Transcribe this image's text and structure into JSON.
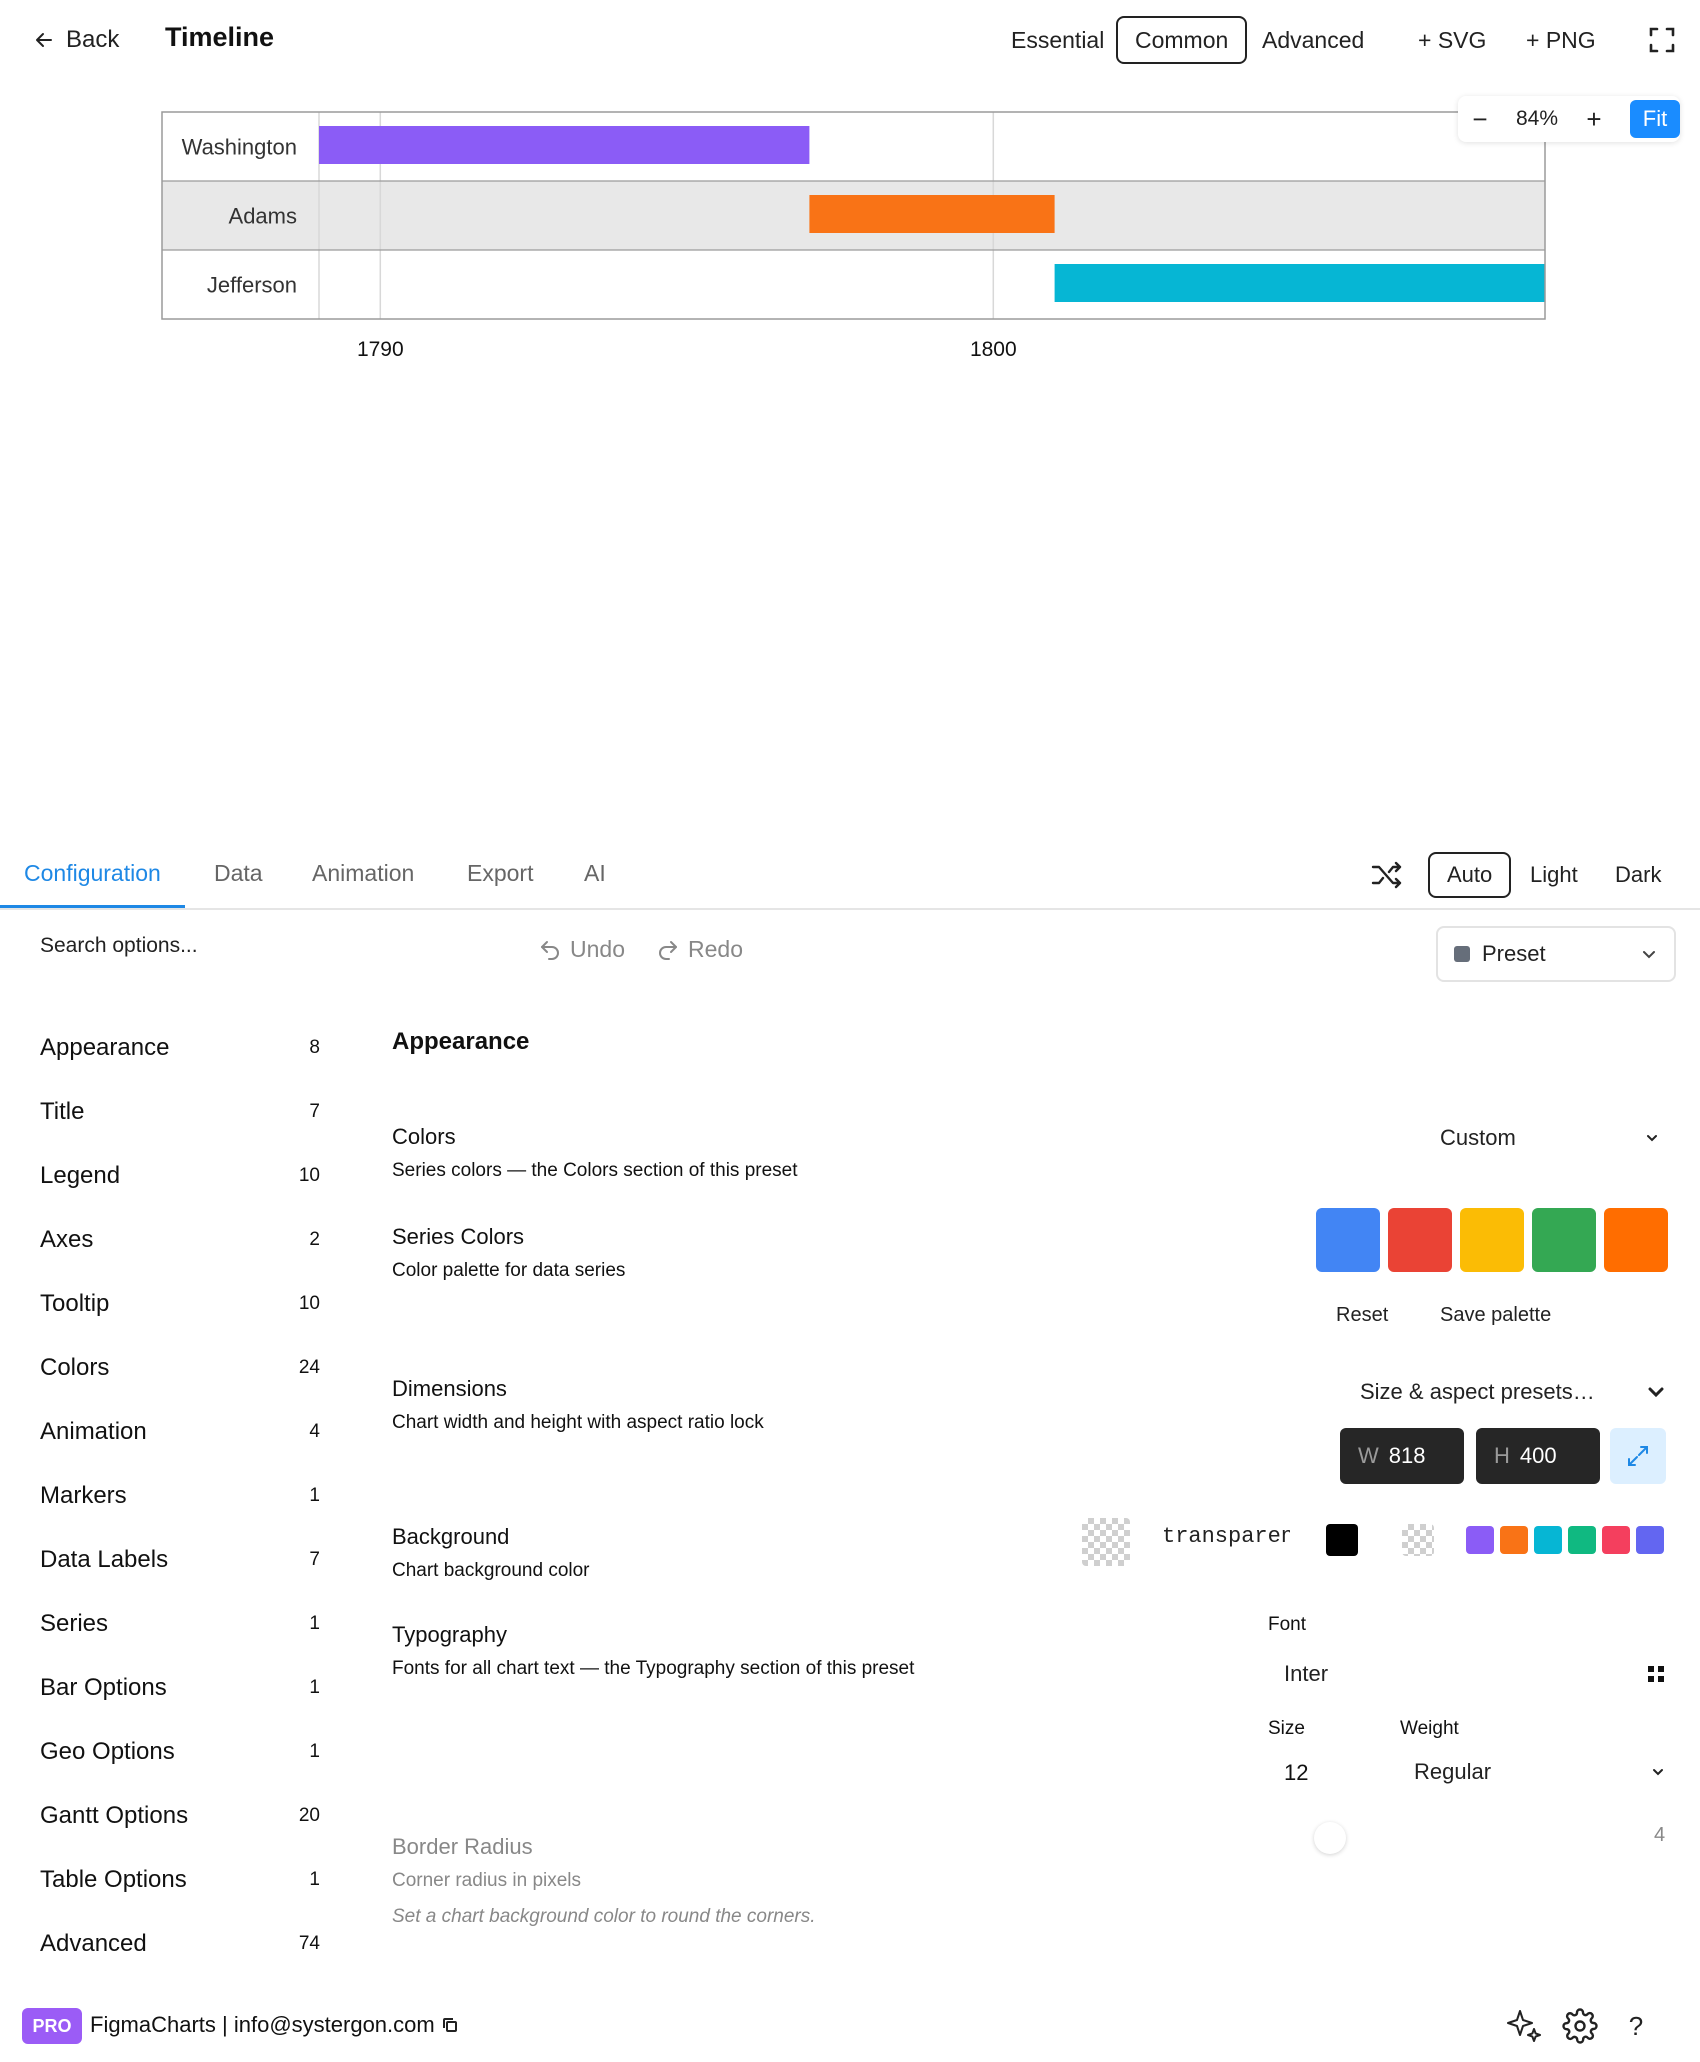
{
  "header": {
    "back_label": "Back",
    "title": "Timeline",
    "modes": [
      "Essential",
      "Common",
      "Advanced"
    ],
    "active_mode": "Common",
    "export_svg": "+ SVG",
    "export_png": "+ PNG"
  },
  "zoom": {
    "minus": "−",
    "value": "84%",
    "plus": "+",
    "fit": "Fit"
  },
  "chart_data": {
    "type": "gantt",
    "categories": [
      "Washington",
      "Adams",
      "Jefferson"
    ],
    "bars": [
      {
        "label": "Washington",
        "start": 1789.0,
        "end": 1797.0,
        "color": "#8b5cf6"
      },
      {
        "label": "Adams",
        "start": 1797.0,
        "end": 1801.0,
        "color": "#f97316"
      },
      {
        "label": "Jefferson",
        "start": 1801.0,
        "end": 1809.0,
        "color": "#06b6d4"
      }
    ],
    "x_ticks": [
      "1790",
      "1800"
    ],
    "xlim": [
      1789.0,
      1809.0
    ],
    "grid": true
  },
  "tabs": [
    "Configuration",
    "Data",
    "Animation",
    "Export",
    "AI"
  ],
  "active_tab": "Configuration",
  "themes": [
    "Auto",
    "Light",
    "Dark"
  ],
  "active_theme": "Auto",
  "toolbar": {
    "search_placeholder": "Search options...",
    "undo": "Undo",
    "redo": "Redo",
    "preset": "Preset"
  },
  "sidebar": {
    "items": [
      {
        "label": "Appearance",
        "count": "8"
      },
      {
        "label": "Title",
        "count": "7"
      },
      {
        "label": "Legend",
        "count": "10"
      },
      {
        "label": "Axes",
        "count": "2"
      },
      {
        "label": "Tooltip",
        "count": "10"
      },
      {
        "label": "Colors",
        "count": "24"
      },
      {
        "label": "Animation",
        "count": "4"
      },
      {
        "label": "Markers",
        "count": "1"
      },
      {
        "label": "Data Labels",
        "count": "7"
      },
      {
        "label": "Series",
        "count": "1"
      },
      {
        "label": "Bar Options",
        "count": "1"
      },
      {
        "label": "Geo Options",
        "count": "1"
      },
      {
        "label": "Gantt Options",
        "count": "20"
      },
      {
        "label": "Table Options",
        "count": "1"
      },
      {
        "label": "Advanced",
        "count": "74"
      }
    ]
  },
  "settings": {
    "section_title": "Appearance",
    "colors": {
      "title": "Colors",
      "desc": "Series colors — the Colors section of this preset",
      "value": "Custom"
    },
    "series_colors": {
      "title": "Series Colors",
      "desc": "Color palette for data series",
      "swatches": [
        "#4285f4",
        "#ea4335",
        "#fbbc05",
        "#34a853",
        "#ff6d00"
      ],
      "reset": "Reset",
      "save": "Save palette"
    },
    "dimensions": {
      "title": "Dimensions",
      "desc": "Chart width and height with aspect ratio lock",
      "presets": "Size & aspect presets…",
      "w_prefix": "W",
      "w_value": "818",
      "h_prefix": "H",
      "h_value": "400"
    },
    "background": {
      "title": "Background",
      "desc": "Chart background color",
      "value": "transparent",
      "quick_colors": [
        "#8b5cf6",
        "#f97316",
        "#06b6d4",
        "#10b981",
        "#f43f5e",
        "#6366f1"
      ]
    },
    "typography": {
      "title": "Typography",
      "desc": "Fonts for all chart text — the Typography section of this preset",
      "font_label": "Font",
      "font_value": "Inter",
      "size_label": "Size",
      "size_value": "12",
      "weight_label": "Weight",
      "weight_value": "Regular"
    },
    "border_radius": {
      "title": "Border Radius",
      "desc": "Corner radius in pixels",
      "hint": "Set a chart background color to round the corners.",
      "value": "4"
    }
  },
  "footer": {
    "badge": "PRO",
    "text": "FigmaCharts | info@systergon.com"
  }
}
